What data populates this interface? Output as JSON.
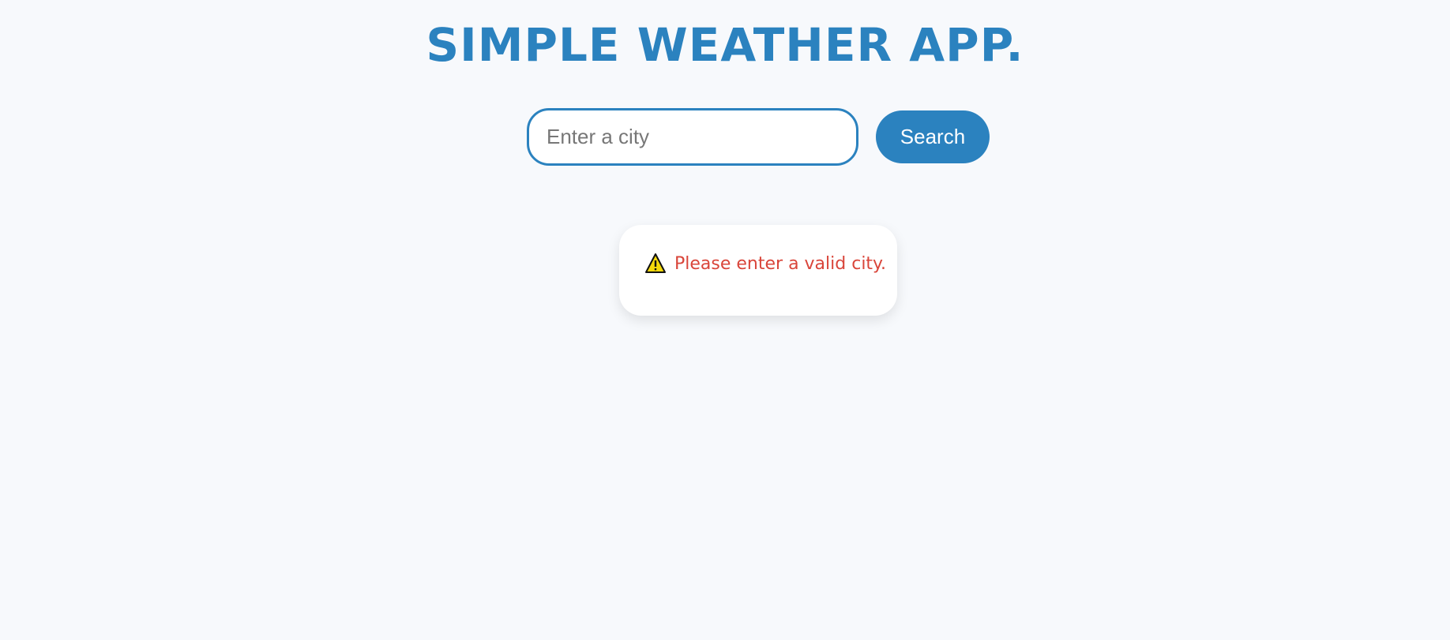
{
  "app": {
    "title": "SIMPLE WEATHER APP."
  },
  "search": {
    "placeholder": "Enter a city",
    "value": "",
    "button_label": "Search"
  },
  "result": {
    "error_icon": "warning-icon",
    "error_message": "Please enter a valid city."
  },
  "colors": {
    "background": "#f7f9fc",
    "accent": "#2b82bf",
    "error": "#d9453a",
    "card": "#ffffff"
  }
}
